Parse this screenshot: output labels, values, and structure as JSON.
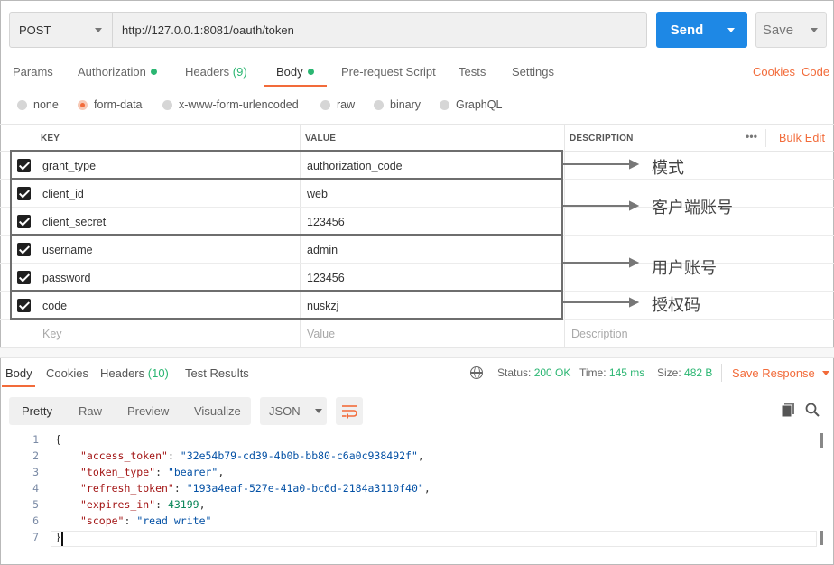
{
  "request": {
    "method": "POST",
    "url": "http://127.0.0.1:8081/oauth/token",
    "send_label": "Send",
    "save_label": "Save"
  },
  "tabs": {
    "params": "Params",
    "authorization": "Authorization",
    "headers": "Headers",
    "headers_count": "(9)",
    "body": "Body",
    "prerequest": "Pre-request Script",
    "tests": "Tests",
    "settings": "Settings",
    "cookies": "Cookies",
    "code": "Code"
  },
  "body_types": [
    "none",
    "form-data",
    "x-www-form-urlencoded",
    "raw",
    "binary",
    "GraphQL"
  ],
  "body_type_selected": "form-data",
  "table": {
    "headers": {
      "key": "KEY",
      "value": "VALUE",
      "description": "DESCRIPTION"
    },
    "bulk_edit": "Bulk Edit",
    "more": "•••",
    "rows": [
      {
        "key": "grant_type",
        "value": "authorization_code"
      },
      {
        "key": "client_id",
        "value": "web"
      },
      {
        "key": "client_secret",
        "value": "123456"
      },
      {
        "key": "username",
        "value": "admin"
      },
      {
        "key": "password",
        "value": "123456"
      },
      {
        "key": "code",
        "value": "nuskzj"
      }
    ],
    "placeholder": {
      "key": "Key",
      "value": "Value",
      "description": "Description"
    }
  },
  "annotations": [
    "模式",
    "客户端账号",
    "用户账号",
    "授权码"
  ],
  "response": {
    "tabs": {
      "body": "Body",
      "cookies": "Cookies",
      "headers": "Headers",
      "headers_count": "(10)",
      "tests": "Test Results"
    },
    "status_label": "Status:",
    "status_value": "200 OK",
    "time_label": "Time:",
    "time_value": "145 ms",
    "size_label": "Size:",
    "size_value": "482 B",
    "save_response": "Save Response",
    "views": [
      "Pretty",
      "Raw",
      "Preview",
      "Visualize"
    ],
    "format": "JSON"
  },
  "code": {
    "line_numbers": [
      "1",
      "2",
      "3",
      "4",
      "5",
      "6",
      "7"
    ],
    "open": "{",
    "close": "}",
    "entries": [
      {
        "key": "\"access_token\"",
        "value": "\"32e54b79-cd39-4b0b-bb80-c6a0c938492f\"",
        "type": "string",
        "comma": ","
      },
      {
        "key": "\"token_type\"",
        "value": "\"bearer\"",
        "type": "string",
        "comma": ","
      },
      {
        "key": "\"refresh_token\"",
        "value": "\"193a4eaf-527e-41a0-bc6d-2184a3110f40\"",
        "type": "string",
        "comma": ","
      },
      {
        "key": "\"expires_in\"",
        "value": "43199",
        "type": "number",
        "comma": ","
      },
      {
        "key": "\"scope\"",
        "value": "\"read write\"",
        "type": "string",
        "comma": ""
      }
    ]
  },
  "colors": {
    "accent": "#f26b3a",
    "send": "#1e88e5",
    "success": "#2bb672"
  }
}
